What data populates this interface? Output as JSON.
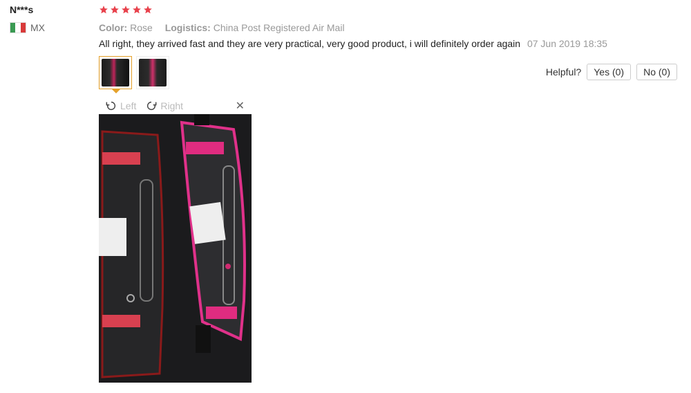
{
  "reviewer": {
    "name": "N***s",
    "country": "MX",
    "flag_colors": [
      "#3a9a52",
      "#ffffff",
      "#d93a3a"
    ]
  },
  "rating": {
    "stars": 5,
    "max": 5,
    "color": "#e8414b"
  },
  "meta": {
    "color_label": "Color:",
    "color_value": "Rose",
    "logistics_label": "Logistics:",
    "logistics_value": "China Post Registered Air Mail"
  },
  "review": {
    "text": "All right, they arrived fast and they are very practical, very good product, i will definitely order again",
    "date": "07 Jun 2019 18:35"
  },
  "thumbnails": [
    {
      "selected": true
    },
    {
      "selected": false
    }
  ],
  "helpful": {
    "label": "Helpful?",
    "yes": "Yes (0)",
    "no": "No (0)"
  },
  "viewer": {
    "left_label": "Left",
    "right_label": "Right",
    "close_glyph": "✕"
  },
  "accent_color": "#e5a12a"
}
